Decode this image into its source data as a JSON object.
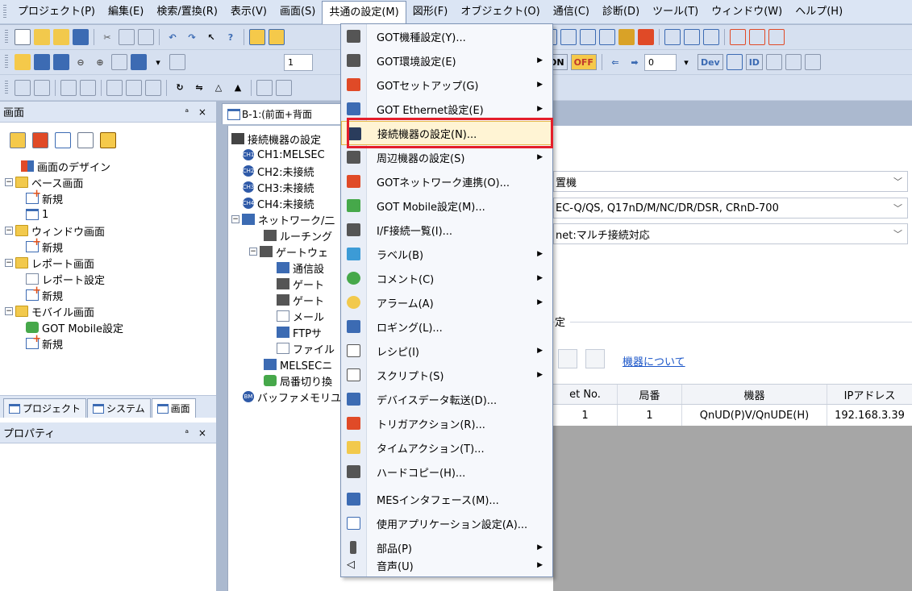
{
  "menubar": {
    "items": [
      "プロジェクト(P)",
      "編集(E)",
      "検索/置換(R)",
      "表示(V)",
      "画面(S)",
      "共通の設定(M)",
      "図形(F)",
      "オブジェクト(O)",
      "通信(C)",
      "診断(D)",
      "ツール(T)",
      "ウィンドウ(W)",
      "ヘルプ(H)"
    ],
    "active_index": 5
  },
  "toolbar": {
    "combo1_value": "1",
    "combo2_value": "0",
    "on_label": "ON",
    "off_label": "OFF",
    "dev_label": "Dev",
    "id_label": "ID"
  },
  "left_panel": {
    "title": "画面",
    "pins": "ᵃ ×",
    "tree": [
      {
        "label": "画面のデザイン",
        "icon": "design-icon",
        "level": 1
      },
      {
        "label": "ベース画面",
        "icon": "folder-icon",
        "level": 0,
        "expander": "−"
      },
      {
        "label": "新規",
        "icon": "new-screen-icon",
        "level": 1
      },
      {
        "label": "1",
        "icon": "screen-icon",
        "level": 1
      },
      {
        "label": "ウィンドウ画面",
        "icon": "folder-icon",
        "level": 0,
        "expander": "−"
      },
      {
        "label": "新規",
        "icon": "new-screen-icon",
        "level": 1
      },
      {
        "label": "レポート画面",
        "icon": "folder-icon",
        "level": 0,
        "expander": "−"
      },
      {
        "label": "レポート設定",
        "icon": "report-icon",
        "level": 1
      },
      {
        "label": "新規",
        "icon": "new-screen-icon",
        "level": 1
      },
      {
        "label": "モバイル画面",
        "icon": "folder-icon",
        "level": 0,
        "expander": "−"
      },
      {
        "label": "GOT Mobile設定",
        "icon": "mobile-icon",
        "level": 1
      },
      {
        "label": "新規",
        "icon": "new-screen-icon",
        "level": 1
      }
    ],
    "bottom_tabs": [
      "プロジェクト",
      "システム",
      "画面"
    ],
    "property_title": "プロパティ"
  },
  "doc_tab": {
    "label": "B-1:(前面+背面"
  },
  "center_tree": [
    {
      "label": "接続機器の設定",
      "icon": "device-icon",
      "x": 0
    },
    {
      "label": "CH1:MELSEC",
      "badge": "CH1",
      "x": 1
    },
    {
      "label": "CH2:未接続",
      "badge": "CH2",
      "x": 1
    },
    {
      "label": "CH3:未接続",
      "badge": "CH3",
      "x": 1
    },
    {
      "label": "CH4:未接続",
      "badge": "CH4",
      "x": 1
    },
    {
      "label": "ネットワーク/二",
      "icon": "network-icon",
      "x": 0
    },
    {
      "label": "ルーチング",
      "icon": "routing-icon",
      "x": 2
    },
    {
      "label": "ゲートウェ",
      "icon": "gateway-icon",
      "x": 1
    },
    {
      "label": "通信設",
      "icon": "comm-icon",
      "x": 3
    },
    {
      "label": "ゲート",
      "icon": "gateway-icon",
      "x": 3
    },
    {
      "label": "ゲート",
      "icon": "gateway-icon",
      "x": 3
    },
    {
      "label": "メール",
      "icon": "mail-icon",
      "x": 3
    },
    {
      "label": "FTPサ",
      "icon": "ftp-icon",
      "x": 3
    },
    {
      "label": "ファイル",
      "icon": "file-icon",
      "x": 3
    },
    {
      "label": "MELSECニ",
      "icon": "melsec-icon",
      "x": 2
    },
    {
      "label": "局番切り換",
      "icon": "station-icon",
      "x": 2
    },
    {
      "label": "バッファメモリユ",
      "icon": "buffer-icon",
      "x": 0
    }
  ],
  "right_form": {
    "select1": "置機",
    "select2": "EC-Q/QS, Q17nD/M/NC/DR/DSR, CRnD-700",
    "select3": "net:マルチ接続対応",
    "fieldset_label": "定",
    "link": "機器について",
    "grid_headers": [
      "et No.",
      "局番",
      "機器",
      "IPアドレス"
    ],
    "grid_rows": [
      [
        "1",
        "1",
        "QnUD(P)V/QnUDE(H)",
        "192.168.3.39"
      ]
    ]
  },
  "dropdown": {
    "items": [
      {
        "label": "GOT機種設定(Y)...",
        "icon": "got-model-icon",
        "submenu": false
      },
      {
        "label": "GOT環境設定(E)",
        "icon": "got-env-icon",
        "submenu": true
      },
      {
        "label": "GOTセットアップ(G)",
        "icon": "got-setup-icon",
        "submenu": true
      },
      {
        "label": "GOT Ethernet設定(E)",
        "icon": "ethernet-icon",
        "submenu": true
      },
      {
        "label": "接続機器の設定(N)...",
        "icon": "connect-device-icon",
        "submenu": false,
        "highlighted": true
      },
      {
        "label": "周辺機器の設定(S)",
        "icon": "peripheral-icon",
        "submenu": true
      },
      {
        "label": "GOTネットワーク連携(O)...",
        "icon": "got-network-icon",
        "submenu": false
      },
      {
        "label": "GOT Mobile設定(M)...",
        "icon": "got-mobile-icon",
        "submenu": false
      },
      {
        "label": "I/F接続一覧(I)...",
        "icon": "if-list-icon",
        "submenu": false
      },
      {
        "label": "ラベル(B)",
        "icon": "label-icon",
        "submenu": true
      },
      {
        "label": "コメント(C)",
        "icon": "comment-icon",
        "submenu": true
      },
      {
        "label": "アラーム(A)",
        "icon": "alarm-icon",
        "submenu": true
      },
      {
        "label": "ロギング(L)...",
        "icon": "logging-icon",
        "submenu": false
      },
      {
        "label": "レシピ(I)",
        "icon": "recipe-icon",
        "submenu": true
      },
      {
        "label": "スクリプト(S)",
        "icon": "script-icon",
        "submenu": true
      },
      {
        "label": "デバイスデータ転送(D)...",
        "icon": "device-transfer-icon",
        "submenu": false
      },
      {
        "label": "トリガアクション(R)...",
        "icon": "trigger-action-icon",
        "submenu": false
      },
      {
        "label": "タイムアクション(T)...",
        "icon": "time-action-icon",
        "submenu": false
      },
      {
        "label": "ハードコピー(H)...",
        "icon": "hardcopy-icon",
        "submenu": false
      },
      {
        "label": "MESインタフェース(M)...",
        "icon": "mes-icon",
        "submenu": false
      },
      {
        "label": "使用アプリケーション設定(A)...",
        "icon": "app-settings-icon",
        "submenu": false
      },
      {
        "label": "部品(P)",
        "icon": "parts-icon",
        "submenu": true
      },
      {
        "label": "音声(U)",
        "icon": "sound-icon",
        "submenu": true
      }
    ]
  },
  "colors": {
    "highlight_border": "#e41e2b",
    "menu_hover": "#fff4d4",
    "accent_blue": "#2f5aa8"
  }
}
